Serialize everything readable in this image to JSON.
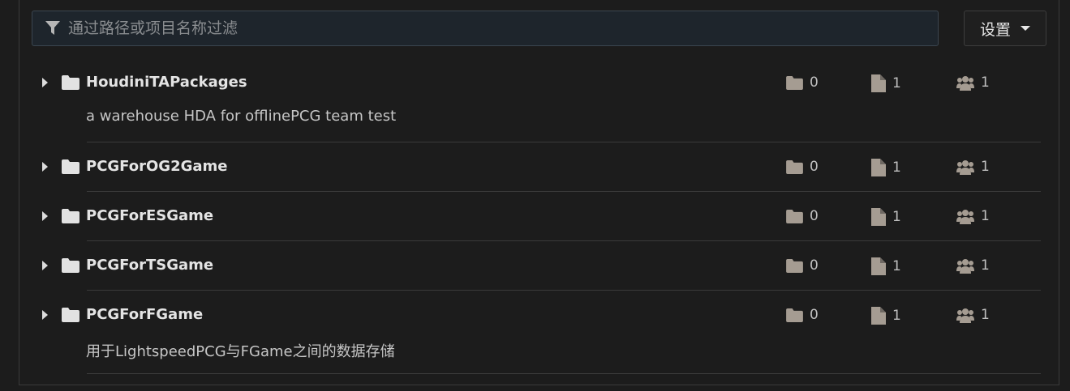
{
  "search": {
    "placeholder": "通过路径或项目名称过滤",
    "icon": "filter-icon"
  },
  "settings": {
    "label": "设置",
    "icon": "caret-down-icon"
  },
  "colors": {
    "background": "#1c1c1c",
    "search_background": "#1e252c",
    "icon_gray": "#a59c92"
  },
  "repos": [
    {
      "name": "HoudiniTAPackages",
      "description": "a warehouse HDA for offlinePCG team test",
      "dirs": "0",
      "files": "1",
      "members": "1"
    },
    {
      "name": "PCGForOG2Game",
      "description": "",
      "dirs": "0",
      "files": "1",
      "members": "1"
    },
    {
      "name": "PCGForESGame",
      "description": "",
      "dirs": "0",
      "files": "1",
      "members": "1"
    },
    {
      "name": "PCGForTSGame",
      "description": "",
      "dirs": "0",
      "files": "1",
      "members": "1"
    },
    {
      "name": "PCGForFGame",
      "description": "用于LightspeedPCG与FGame之间的数据存储",
      "dirs": "0",
      "files": "1",
      "members": "1"
    }
  ]
}
